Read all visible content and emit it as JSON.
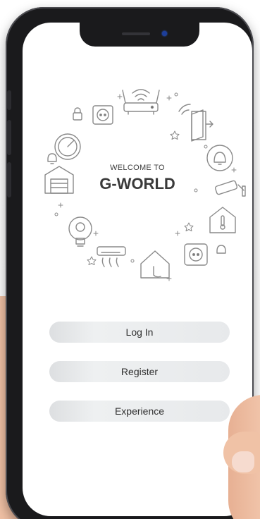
{
  "welcome": {
    "prefix": "WELCOME TO",
    "brand": "G-WORLD"
  },
  "actions": {
    "login_label": "Log In",
    "register_label": "Register",
    "experience_label": "Experience"
  },
  "icons": [
    "wifi-router-icon",
    "door-icon",
    "bell-icon",
    "security-camera-icon",
    "thermometer-house-icon",
    "power-socket-icon",
    "alarm-icon",
    "smart-home-touch-icon",
    "air-conditioner-icon",
    "lightbulb-icon",
    "garage-icon",
    "gauge-icon",
    "lock-icon",
    "plug-icon",
    "sparkle-icon"
  ],
  "colors": {
    "camera_dot": "#1d3e9a",
    "button_bg": "#e7e9eb",
    "text": "#2f2f2f"
  }
}
